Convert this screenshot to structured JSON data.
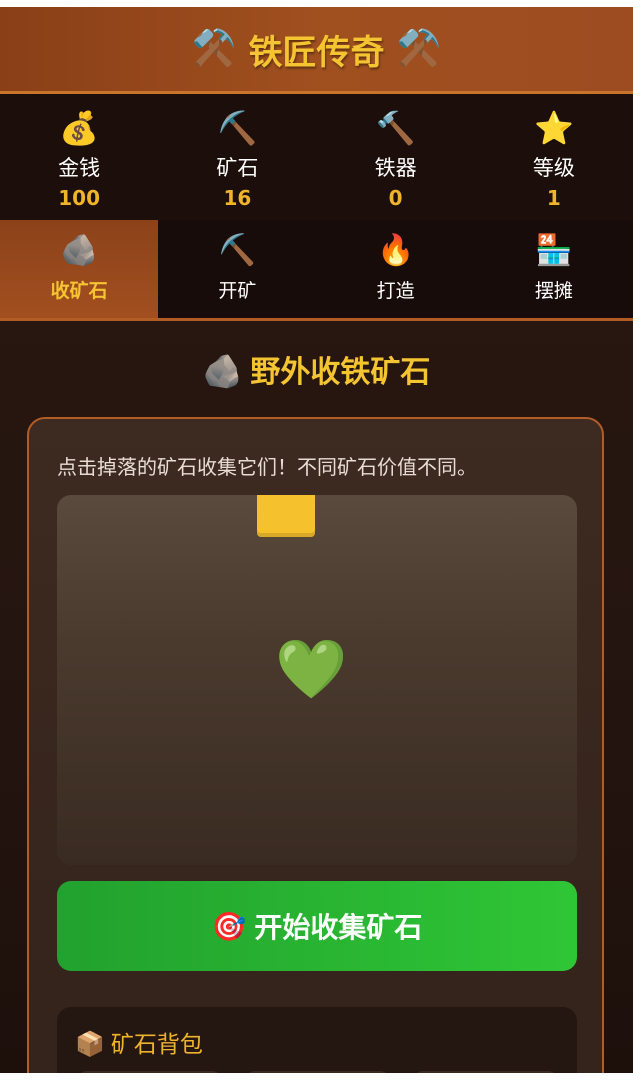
{
  "header": {
    "left_icon": "⚒️",
    "title": "铁匠传奇",
    "right_icon": "⚒️"
  },
  "stats": [
    {
      "icon": "💰",
      "label": "金钱",
      "value": "100"
    },
    {
      "icon": "⛏️",
      "label": "矿石",
      "value": "16"
    },
    {
      "icon": "🔨",
      "label": "铁器",
      "value": "0"
    },
    {
      "icon": "⭐",
      "label": "等级",
      "value": "1"
    }
  ],
  "tabs": [
    {
      "icon": "🪨",
      "label": "收矿石",
      "active": true
    },
    {
      "icon": "⛏️",
      "label": "开矿",
      "active": false
    },
    {
      "icon": "🔥",
      "label": "打造",
      "active": false
    },
    {
      "icon": "🏪",
      "label": "摆摊",
      "active": false
    }
  ],
  "section": {
    "icon": "🪨",
    "title": "野外收铁矿石"
  },
  "panel": {
    "description": "点击掉落的矿石收集它们！不同矿石价值不同。",
    "heart_icon": "💚",
    "start_icon": "🎯",
    "start_label": "开始收集矿石"
  },
  "backpack": {
    "icon": "📦",
    "title": "矿石背包"
  },
  "colors": {
    "accent_gold": "#f5c431",
    "header_brown": "#a0501f",
    "start_green": "#2fc636"
  }
}
